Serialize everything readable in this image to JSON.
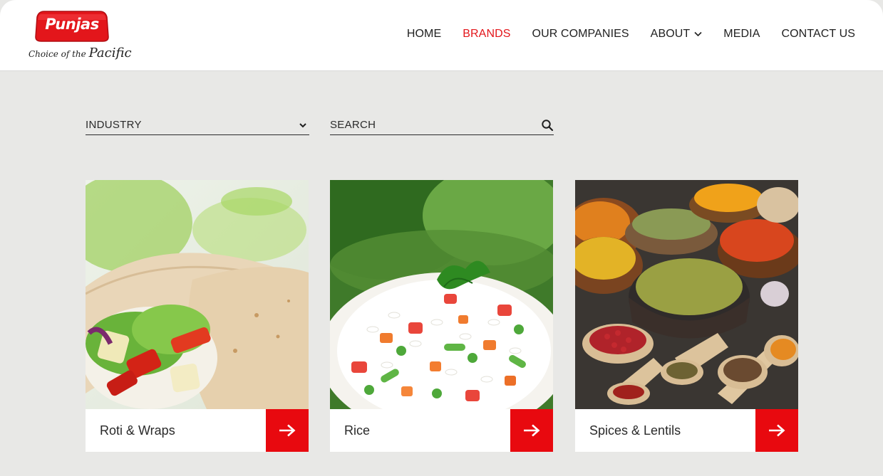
{
  "brand": {
    "logo_text": "Punjas",
    "tagline_prefix": "Choice of the",
    "tagline_script": "Pacific",
    "brand_red": "#e3161b"
  },
  "nav": {
    "items": [
      {
        "label": "HOME",
        "active": false
      },
      {
        "label": "BRANDS",
        "active": true
      },
      {
        "label": "OUR COMPANIES",
        "active": false
      },
      {
        "label": "ABOUT",
        "active": false,
        "has_dropdown": true
      },
      {
        "label": "MEDIA",
        "active": false
      },
      {
        "label": "CONTACT US",
        "active": false
      }
    ]
  },
  "filters": {
    "industry_label": "INDUSTRY",
    "search_placeholder": "SEARCH"
  },
  "cards": [
    {
      "title": "Roti & Wraps",
      "image": "wrap-photo"
    },
    {
      "title": "Rice",
      "image": "rice-photo"
    },
    {
      "title": "Spices & Lentils",
      "image": "spices-photo"
    }
  ],
  "colors": {
    "page_bg": "#e8e8e6",
    "arrow_bg": "#e8090f",
    "active_nav": "#e3161b"
  }
}
